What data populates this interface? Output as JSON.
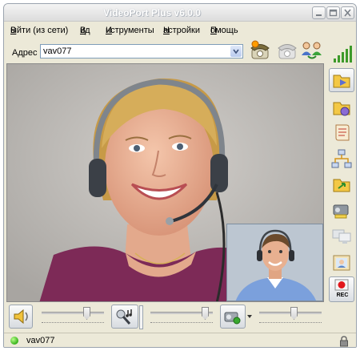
{
  "window": {
    "title": "VideoPort Plus v6.0.0"
  },
  "menu": {
    "items": [
      {
        "label": "Выйти (из сети)",
        "underline": "В",
        "rest": "ыйти (из сети)"
      },
      {
        "label": "Вид",
        "underline": "В",
        "rest": "ид"
      },
      {
        "label": "Инструменты",
        "underline": "И",
        "rest": "нструменты"
      },
      {
        "label": "Настройки",
        "underline": "Н",
        "rest": "астройки"
      },
      {
        "label": "Помощь",
        "underline": "П",
        "rest": "омощь"
      }
    ]
  },
  "address": {
    "label": "Адрес :",
    "value": "vav077"
  },
  "toolbar": {
    "icons": [
      "phone-dial-icon",
      "phone-hangup-icon",
      "contacts-group-icon"
    ]
  },
  "sidebar": {
    "buttons": [
      "signal-strength-icon",
      "video-folder-icon",
      "video-settings-icon",
      "scroll-document-icon",
      "network-diagram-icon",
      "folder-transfer-icon",
      "camera-projector-icon",
      "monitors-icon",
      "photo-frame-icon",
      "record-icon"
    ],
    "rec_label": "REC"
  },
  "controls": {
    "speaker_volume_level": 0.75,
    "mic_volume_level": 0.93,
    "camera_level": 0.56
  },
  "status": {
    "text": "vav077",
    "indicator_color": "#35b11a"
  }
}
